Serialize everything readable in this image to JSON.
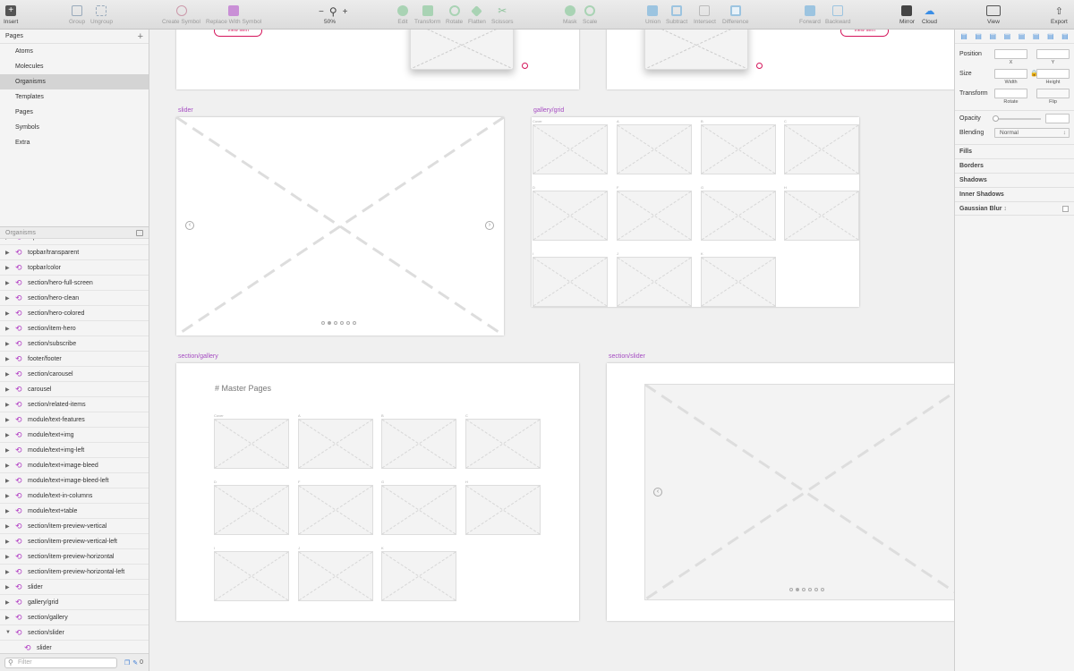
{
  "toolbar": {
    "insert": "Insert",
    "group": "Group",
    "ungroup": "Ungroup",
    "create_symbol": "Create Symbol",
    "replace_with_symbol": "Replace With Symbol",
    "zoom": "50%",
    "edit": "Edit",
    "transform": "Transform",
    "rotate": "Rotate",
    "flatten": "Flatten",
    "scissors": "Scissors",
    "mask": "Mask",
    "scale": "Scale",
    "union": "Union",
    "subtract": "Subtract",
    "intersect": "Intersect",
    "difference": "Difference",
    "forward": "Forward",
    "backward": "Backward",
    "mirror": "Mirror",
    "cloud": "Cloud",
    "view": "View",
    "export": "Export"
  },
  "pages": {
    "header": "Pages",
    "items": [
      "Atoms",
      "Molecules",
      "Organisms",
      "Templates",
      "Pages",
      "Symbols",
      "Extra"
    ],
    "selected": "Organisms"
  },
  "layers": {
    "header": "Organisms",
    "items": [
      "topbar/white",
      "topbar/transparent",
      "topbar/color",
      "section/hero-full-screen",
      "section/hero-clean",
      "section/hero-colored",
      "section/item-hero",
      "section/subscribe",
      "footer/footer",
      "section/carousel",
      "carousel",
      "section/related-items",
      "module/text-features",
      "module/text+img",
      "module/text+img-left",
      "module/text+image-bleed",
      "module/text+image-bleed-left",
      "module/text-in-columns",
      "module/text+table",
      "section/item-preview-vertical",
      "section/item-preview-vertical-left",
      "section/item-preview-horizontal",
      "section/item-preview-horizontal-left",
      "slider",
      "gallery/grid",
      "section/gallery",
      "section/slider"
    ],
    "expanded_child": "slider",
    "filter_placeholder": "Filter",
    "bottom_count": "0"
  },
  "canvas": {
    "labels": {
      "slider": "slider",
      "gallery_grid": "gallery/grid",
      "section_gallery": "section/gallery",
      "section_slider": "section/slider"
    },
    "view_item": "View Item",
    "master_pages": "# Master Pages",
    "grid_letters": [
      "Cover",
      "A",
      "B",
      "C",
      "D",
      "F",
      "G",
      "H",
      "I",
      "J",
      "K"
    ]
  },
  "inspector": {
    "position": "Position",
    "x": "X",
    "y": "Y",
    "size": "Size",
    "width": "Width",
    "height": "Height",
    "transform": "Transform",
    "rotate": "Rotate",
    "flip": "Flip",
    "opacity": "Opacity",
    "blending": "Blending",
    "blending_value": "Normal",
    "fills": "Fills",
    "borders": "Borders",
    "shadows": "Shadows",
    "inner_shadows": "Inner Shadows",
    "gaussian_blur": "Gaussian Blur"
  },
  "colors": {
    "accent": "#d4145a",
    "symbol": "#b13cc4",
    "artboard_label": "#a54cc2",
    "selection": "#d4d4d4"
  }
}
